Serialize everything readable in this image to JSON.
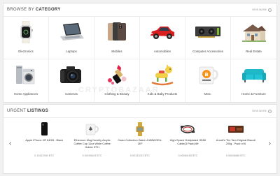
{
  "browse": {
    "title_prefix": "BROWSE BY",
    "title_bold": "CATEGORY",
    "view_more": "VIEW MORE",
    "categories": [
      {
        "label": "Electronics",
        "icon": "smartwatch-icon"
      },
      {
        "label": "Laptops",
        "icon": "laptop-icon"
      },
      {
        "label": "Mobiles",
        "icon": "smartphone-icon"
      },
      {
        "label": "Automobiles",
        "icon": "car-icon"
      },
      {
        "label": "Computer Accessories",
        "icon": "graphics-card-icon"
      },
      {
        "label": "Real Estate",
        "icon": "house-icon"
      },
      {
        "label": "Home Appliances",
        "icon": "washing-machine-icon"
      },
      {
        "label": "Cameras",
        "icon": "camera-icon"
      },
      {
        "label": "Clothing & Beauty",
        "icon": "lipstick-icon"
      },
      {
        "label": "Kids & Baby Products",
        "icon": "rocking-horse-icon"
      },
      {
        "label": "Misc.",
        "icon": "bitcoin-mug-icon"
      },
      {
        "label": "Home & Furniture",
        "icon": "sofa-icon"
      }
    ]
  },
  "urgent": {
    "title_prefix": "URGENT",
    "title_bold": "LISTINGS",
    "view_more": "VIEW MORE",
    "listings": [
      {
        "title": "Apple iPhone XR 64GB - Black",
        "price": "0.13412930 BTC",
        "icon": "phone-icon"
      },
      {
        "title": "Ethereum Mug Novelty Acrylic Coffee Cup 11oz White Coffee Holder ETH",
        "price": "0.00195424 BTC",
        "icon": "mug-icon"
      },
      {
        "title": "Casio Collection Watch A158WGEA-1EF",
        "price": "0.00131013 BTC",
        "icon": "watch-icon"
      },
      {
        "title": "High-Speed Goldplated HDMI Cable(3 Pack) 6ft",
        "price": "0.00064183 BTC",
        "icon": "hdmi-cable-icon"
      },
      {
        "title": "Arnott's Tim Tam Original Biscuit 200g - Pack of 6",
        "price": "0.00026685 BTC",
        "icon": "biscuit-pack-icon"
      }
    ]
  },
  "watermark": "CRYPTOBAZAAR"
}
